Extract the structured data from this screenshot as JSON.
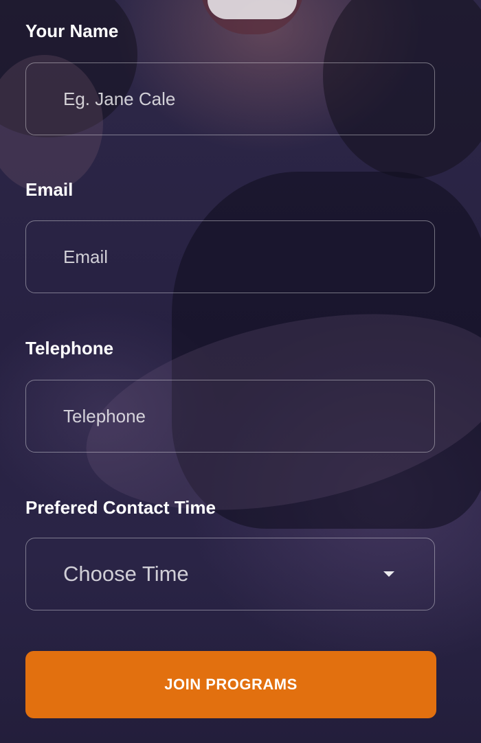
{
  "form": {
    "name": {
      "label": "Your Name",
      "placeholder": "Eg. Jane Cale"
    },
    "email": {
      "label": "Email",
      "placeholder": "Email"
    },
    "telephone": {
      "label": "Telephone",
      "placeholder": "Telephone"
    },
    "contact_time": {
      "label": "Prefered Contact Time",
      "selected": "Choose Time"
    },
    "submit_label": "JOIN PROGRAMS"
  },
  "icons": {
    "select_caret": "chevron-down-icon"
  },
  "colors": {
    "button": "#e2700f",
    "overlay": "#241f3f",
    "text": "#ffffff"
  }
}
